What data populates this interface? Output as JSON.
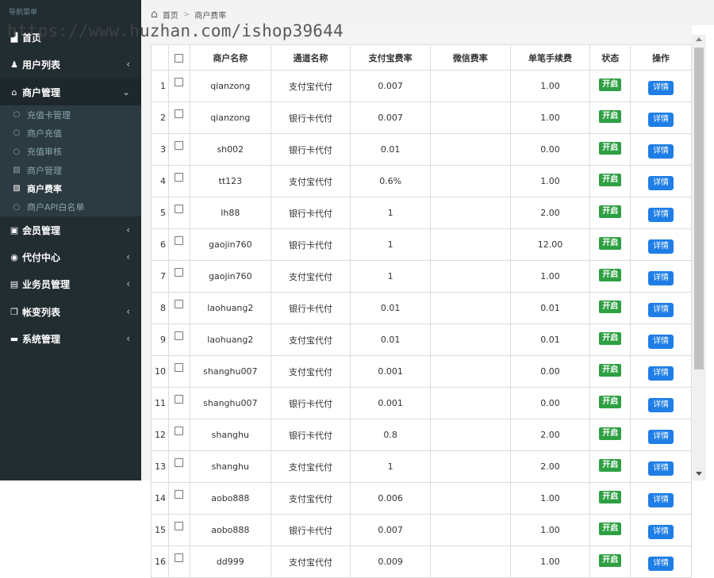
{
  "sidebar": {
    "caption": "导航菜单",
    "items": [
      {
        "icon": "bar-chart-icon",
        "glyph": "▟",
        "label": "首页",
        "arrow": ""
      },
      {
        "icon": "user-icon",
        "glyph": "♟",
        "label": "用户列表",
        "arrow": "‹"
      },
      {
        "icon": "bank-icon",
        "glyph": "⌂",
        "label": "商户管理",
        "arrow": "⌄"
      },
      {
        "icon": "id-card-icon",
        "glyph": "▣",
        "label": "会员管理",
        "arrow": "‹"
      },
      {
        "icon": "globe-icon",
        "glyph": "◉",
        "label": "代付中心",
        "arrow": "‹"
      },
      {
        "icon": "contact-icon",
        "glyph": "▤",
        "label": "业务员管理",
        "arrow": "‹"
      },
      {
        "icon": "copy-icon",
        "glyph": "❐",
        "label": "帐变列表",
        "arrow": "‹"
      },
      {
        "icon": "credit-card-icon",
        "glyph": "▬",
        "label": "系统管理",
        "arrow": "‹"
      }
    ],
    "submenu": [
      {
        "icon": "circle-icon",
        "glyph": "○",
        "label": "充值卡管理",
        "active": false
      },
      {
        "icon": "circle-icon",
        "glyph": "○",
        "label": "商户充值",
        "active": false
      },
      {
        "icon": "circle-icon",
        "glyph": "○",
        "label": "充值审核",
        "active": false
      },
      {
        "icon": "file-icon",
        "glyph": "▧",
        "label": "商户管理",
        "active": false
      },
      {
        "icon": "file-icon",
        "glyph": "▧",
        "label": "商户费率",
        "active": true
      },
      {
        "icon": "circle-icon",
        "glyph": "○",
        "label": "商户API白名单",
        "active": false
      }
    ]
  },
  "breadcrumb": {
    "home": "首页",
    "separator": ">",
    "current": "商户费率"
  },
  "watermark": "https://www.huzhan.com/ishop39644",
  "table": {
    "headers": [
      "",
      "",
      "商户名称",
      "通道名称",
      "支付宝费率",
      "微信费率",
      "单笔手续费",
      "状态",
      "操作"
    ],
    "rows": [
      {
        "idx": "1",
        "name": "qianzong",
        "channel": "支付宝代付",
        "alipay": "0.007",
        "wechat": "",
        "fee": "1.00",
        "status": "开启",
        "action": "详情"
      },
      {
        "idx": "2",
        "name": "qianzong",
        "channel": "银行卡代付",
        "alipay": "0.007",
        "wechat": "",
        "fee": "1.00",
        "status": "开启",
        "action": "详情"
      },
      {
        "idx": "3",
        "name": "sh002",
        "channel": "银行卡代付",
        "alipay": "0.01",
        "wechat": "",
        "fee": "0.00",
        "status": "开启",
        "action": "详情"
      },
      {
        "idx": "4",
        "name": "tt123",
        "channel": "支付宝代付",
        "alipay": "0.6%",
        "wechat": "",
        "fee": "1.00",
        "status": "开启",
        "action": "详情"
      },
      {
        "idx": "5",
        "name": "lh88",
        "channel": "银行卡代付",
        "alipay": "1",
        "wechat": "",
        "fee": "2.00",
        "status": "开启",
        "action": "详情"
      },
      {
        "idx": "6",
        "name": "gaojin760",
        "channel": "银行卡代付",
        "alipay": "1",
        "wechat": "",
        "fee": "12.00",
        "status": "开启",
        "action": "详情"
      },
      {
        "idx": "7",
        "name": "gaojin760",
        "channel": "支付宝代付",
        "alipay": "1",
        "wechat": "",
        "fee": "1.00",
        "status": "开启",
        "action": "详情"
      },
      {
        "idx": "8",
        "name": "laohuang2",
        "channel": "银行卡代付",
        "alipay": "0.01",
        "wechat": "",
        "fee": "0.01",
        "status": "开启",
        "action": "详情"
      },
      {
        "idx": "9",
        "name": "laohuang2",
        "channel": "支付宝代付",
        "alipay": "0.01",
        "wechat": "",
        "fee": "0.01",
        "status": "开启",
        "action": "详情"
      },
      {
        "idx": "10",
        "name": "shanghu007",
        "channel": "支付宝代付",
        "alipay": "0.001",
        "wechat": "",
        "fee": "0.00",
        "status": "开启",
        "action": "详情"
      },
      {
        "idx": "11",
        "name": "shanghu007",
        "channel": "银行卡代付",
        "alipay": "0.001",
        "wechat": "",
        "fee": "0.00",
        "status": "开启",
        "action": "详情"
      },
      {
        "idx": "12",
        "name": "shanghu",
        "channel": "银行卡代付",
        "alipay": "0.8",
        "wechat": "",
        "fee": "2.00",
        "status": "开启",
        "action": "详情"
      },
      {
        "idx": "13",
        "name": "shanghu",
        "channel": "支付宝代付",
        "alipay": "1",
        "wechat": "",
        "fee": "2.00",
        "status": "开启",
        "action": "详情"
      },
      {
        "idx": "14",
        "name": "aobo888",
        "channel": "支付宝代付",
        "alipay": "0.006",
        "wechat": "",
        "fee": "1.00",
        "status": "开启",
        "action": "详情"
      },
      {
        "idx": "15",
        "name": "aobo888",
        "channel": "银行卡代付",
        "alipay": "0.007",
        "wechat": "",
        "fee": "1.00",
        "status": "开启",
        "action": "详情"
      },
      {
        "idx": "16",
        "name": "dd999",
        "channel": "支付宝代付",
        "alipay": "0.009",
        "wechat": "",
        "fee": "1.00",
        "status": "开启",
        "action": "详情"
      }
    ]
  },
  "colors": {
    "sidebar_bg": "#222d32",
    "status_green": "#2ea043",
    "button_blue": "#1e7ee6"
  }
}
